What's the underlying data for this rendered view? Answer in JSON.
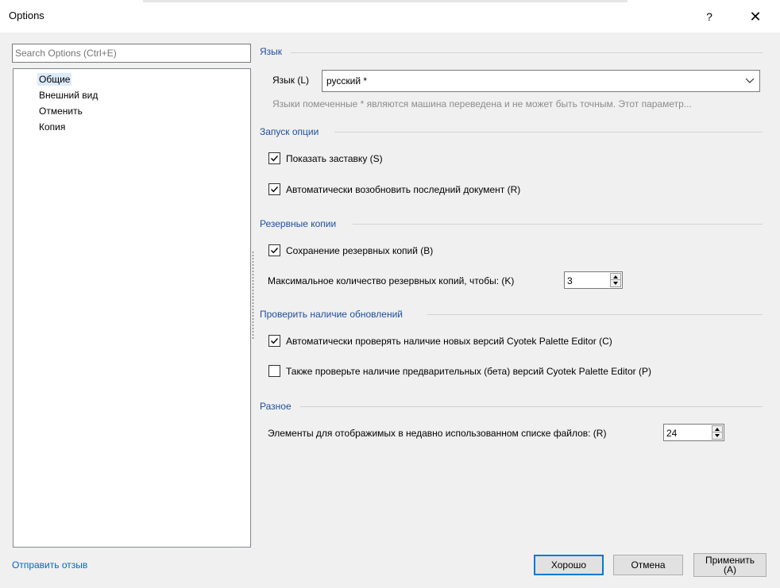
{
  "window": {
    "title": "Options",
    "help_button": "?",
    "close_button": "✕"
  },
  "search": {
    "placeholder": "Search Options (Ctrl+E)"
  },
  "tree": {
    "items": [
      {
        "label": "Общие",
        "selected": true
      },
      {
        "label": "Внешний вид",
        "selected": false
      },
      {
        "label": "Отменить",
        "selected": false
      },
      {
        "label": "Копия",
        "selected": false
      }
    ]
  },
  "language": {
    "section_title": "Язык",
    "field_label": "Язык (L)",
    "selected_value": "русский *",
    "hint": "Языки помеченные * являются машина переведена и не может быть точным. Этот параметр..."
  },
  "startup": {
    "section_title": "Запуск опции",
    "show_splash": {
      "label": "Показать заставку (S)",
      "checked": true
    },
    "auto_resume": {
      "label": "Автоматически возобновить последний документ (R)",
      "checked": true
    }
  },
  "backups": {
    "section_title": "Резервные копии",
    "save_backups": {
      "label": "Сохранение резервных копий (B)",
      "checked": true
    },
    "max_label": "Максимальное количество резервных копий, чтобы: (K)",
    "max_value": "3"
  },
  "updates": {
    "section_title": "Проверить наличие обновлений",
    "auto_check": {
      "label": "Автоматически проверять наличие новых версий Cyotek Palette Editor (C)",
      "checked": true
    },
    "check_beta": {
      "label": "Также проверьте наличие предварительных (бета) версий Cyotek Palette Editor (P)",
      "checked": false
    }
  },
  "misc": {
    "section_title": "Разное",
    "recent_label": "Элементы для отображимых в недавно использованном списке файлов: (R)",
    "recent_value": "24"
  },
  "footer": {
    "feedback_link": "Отправить отзыв",
    "ok_button": "Хорошо",
    "cancel_button": "Отмена",
    "apply_line1": "Применить",
    "apply_line2": "(A)"
  },
  "colors": {
    "accent": "#0078d7",
    "section_title": "#1e4e9e",
    "link": "#0066cc",
    "tree_selection": "#dcebfc"
  }
}
